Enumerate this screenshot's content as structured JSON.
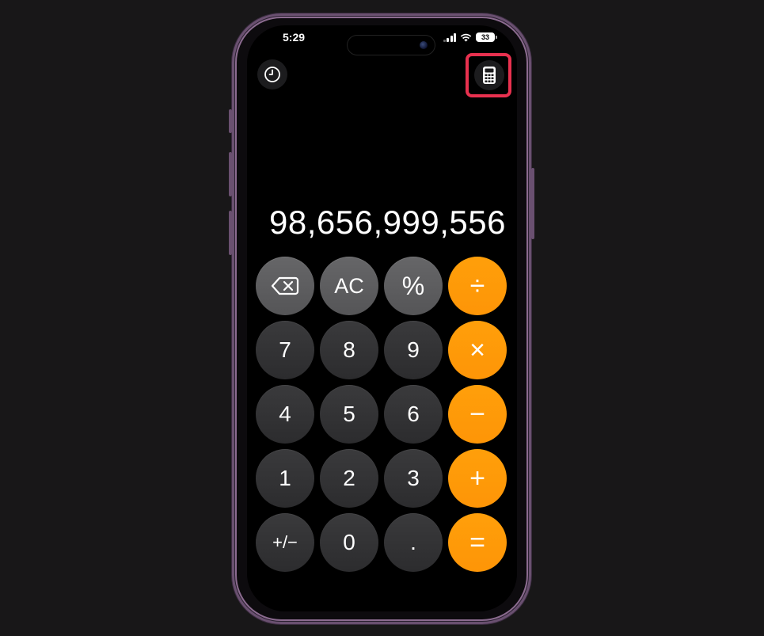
{
  "status_bar": {
    "time": "5:29",
    "battery": "33"
  },
  "toolbar": {
    "history_icon": "clock-icon",
    "mode_icon": "calculator-icon"
  },
  "display": {
    "value": "98,656,999,556"
  },
  "keys": {
    "backspace": {
      "icon": "backspace-icon"
    },
    "ac": "AC",
    "percent": "%",
    "divide": "÷",
    "seven": "7",
    "eight": "8",
    "nine": "9",
    "multiply": "×",
    "four": "4",
    "five": "5",
    "six": "6",
    "minus": "−",
    "one": "1",
    "two": "2",
    "three": "3",
    "plus": "+",
    "plus_minus": "+/−",
    "zero": "0",
    "decimal": ".",
    "equals": "="
  },
  "colors": {
    "operator": "#ff9f0a",
    "function_key": "#5d5d5f",
    "number_key": "#333335",
    "highlight": "#e8314f"
  }
}
